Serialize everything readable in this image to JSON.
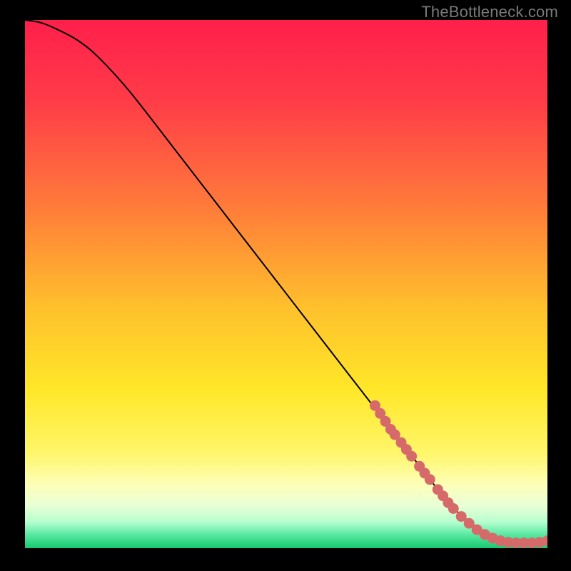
{
  "watermark": "TheBottleneck.com",
  "chart_data": {
    "type": "line",
    "title": "",
    "xlabel": "",
    "ylabel": "",
    "xlim": [
      0,
      100
    ],
    "ylim": [
      0,
      100
    ],
    "gradient_stops": [
      {
        "offset": 0.0,
        "color": "#ff1f4b"
      },
      {
        "offset": 0.15,
        "color": "#ff3b48"
      },
      {
        "offset": 0.35,
        "color": "#ff7a3a"
      },
      {
        "offset": 0.55,
        "color": "#ffc22c"
      },
      {
        "offset": 0.7,
        "color": "#ffe728"
      },
      {
        "offset": 0.82,
        "color": "#fff66a"
      },
      {
        "offset": 0.88,
        "color": "#fdffb8"
      },
      {
        "offset": 0.92,
        "color": "#e8ffd6"
      },
      {
        "offset": 0.95,
        "color": "#b7ffcf"
      },
      {
        "offset": 0.975,
        "color": "#57e8a0"
      },
      {
        "offset": 1.0,
        "color": "#17c971"
      }
    ],
    "series": [
      {
        "name": "bottleneck-curve",
        "x": [
          0,
          3,
          6,
          10,
          14,
          20,
          30,
          40,
          50,
          60,
          68,
          74,
          78,
          80,
          82,
          84,
          86,
          88,
          90,
          92,
          94,
          96,
          98,
          100
        ],
        "y": [
          100,
          99.5,
          98.3,
          96.2,
          93.0,
          86.5,
          73.8,
          61.0,
          48.2,
          35.4,
          25.2,
          17.5,
          12.4,
          9.8,
          7.6,
          5.8,
          4.3,
          3.1,
          2.2,
          1.6,
          1.2,
          1.0,
          1.0,
          1.2
        ]
      }
    ],
    "scatter": {
      "name": "sample-points",
      "color": "#d66a6a",
      "radius": 7.5,
      "points": [
        {
          "x": 67,
          "y": 27
        },
        {
          "x": 68,
          "y": 25.5
        },
        {
          "x": 69,
          "y": 24
        },
        {
          "x": 70,
          "y": 22.5
        },
        {
          "x": 70.8,
          "y": 21.5
        },
        {
          "x": 72,
          "y": 20
        },
        {
          "x": 73,
          "y": 18.7
        },
        {
          "x": 74,
          "y": 17.4
        },
        {
          "x": 75.5,
          "y": 15.5
        },
        {
          "x": 76.5,
          "y": 14.2
        },
        {
          "x": 77.5,
          "y": 13
        },
        {
          "x": 79,
          "y": 11.1
        },
        {
          "x": 80,
          "y": 9.9
        },
        {
          "x": 81,
          "y": 8.6
        },
        {
          "x": 82,
          "y": 7.5
        },
        {
          "x": 83.5,
          "y": 6.0
        },
        {
          "x": 85,
          "y": 4.7
        },
        {
          "x": 86.5,
          "y": 3.5
        },
        {
          "x": 88,
          "y": 2.6
        },
        {
          "x": 89.5,
          "y": 1.9
        },
        {
          "x": 91,
          "y": 1.4
        },
        {
          "x": 92.5,
          "y": 1.1
        },
        {
          "x": 94,
          "y": 1.0
        },
        {
          "x": 95.5,
          "y": 1.0
        },
        {
          "x": 97,
          "y": 1.0
        },
        {
          "x": 98.5,
          "y": 1.1
        },
        {
          "x": 100,
          "y": 1.4
        }
      ]
    }
  }
}
